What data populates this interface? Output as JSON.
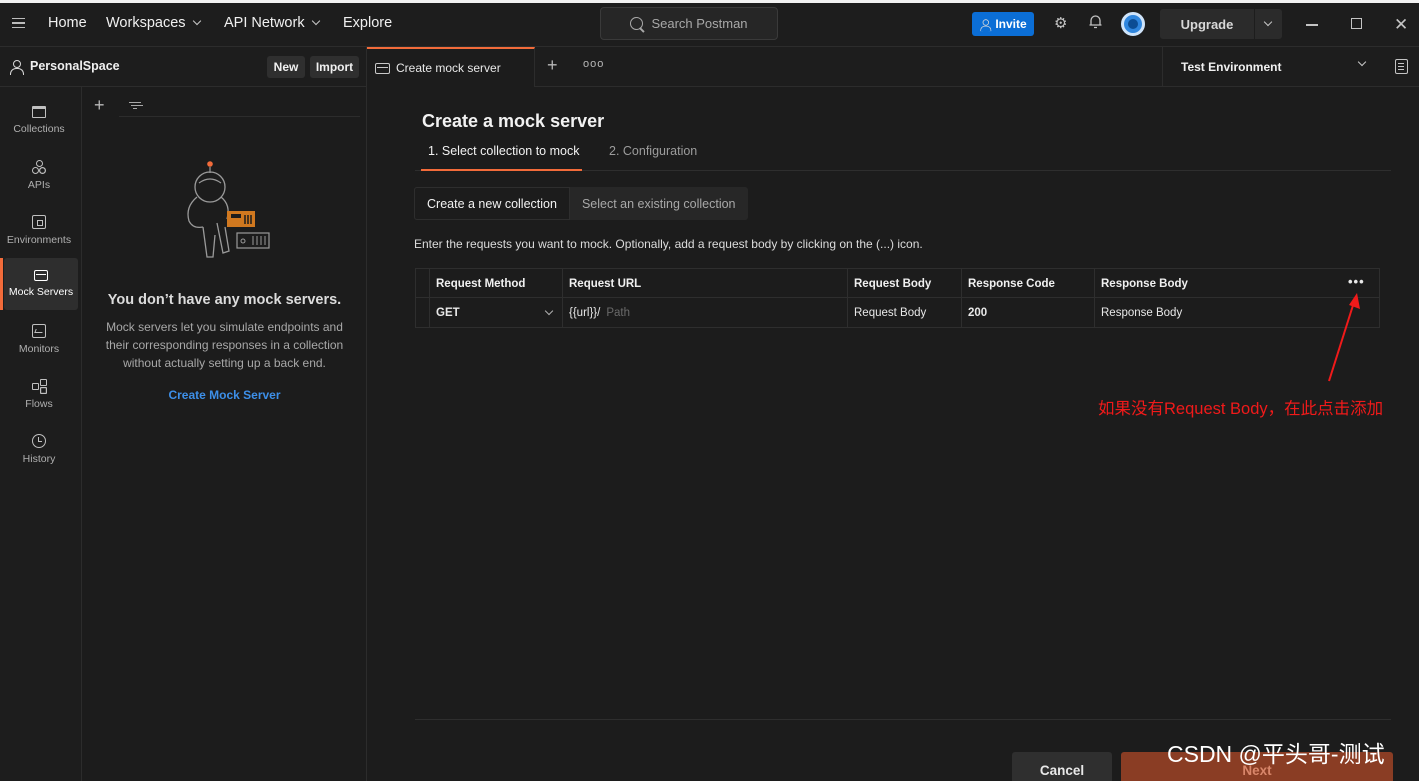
{
  "topbar": {
    "nav": [
      "Home",
      "Workspaces",
      "API Network",
      "Explore"
    ],
    "search_placeholder": "Search Postman",
    "invite_label": "Invite",
    "upgrade_label": "Upgrade"
  },
  "workspace": {
    "name": "PersonalSpace",
    "new_label": "New",
    "import_label": "Import"
  },
  "tabs": {
    "active_label": "Create mock server",
    "more_label": "ooo"
  },
  "environment": {
    "selected": "Test Environment"
  },
  "rail": {
    "items": [
      {
        "label": "Collections",
        "icon": "collections-icon"
      },
      {
        "label": "APIs",
        "icon": "apis-icon"
      },
      {
        "label": "Environments",
        "icon": "environments-icon"
      },
      {
        "label": "Mock Servers",
        "icon": "mock-servers-icon",
        "active": true
      },
      {
        "label": "Monitors",
        "icon": "monitors-icon"
      },
      {
        "label": "Flows",
        "icon": "flows-icon"
      },
      {
        "label": "History",
        "icon": "history-icon"
      }
    ]
  },
  "sidebar": {
    "empty_title": "You don’t have any mock servers.",
    "empty_desc": "Mock servers let you simulate endpoints and their corresponding responses in a collection without actually setting up a back end.",
    "create_link": "Create Mock Server"
  },
  "main": {
    "title": "Create a mock server",
    "steps": [
      "1. Select collection to mock",
      "2. Configuration"
    ],
    "options": [
      "Create a new collection",
      "Select an existing collection"
    ],
    "instruction": "Enter the requests you want to mock. Optionally, add a request body by clicking on the (...) icon.",
    "table": {
      "headers": [
        "Request Method",
        "Request URL",
        "Request Body",
        "Response Code",
        "Response Body"
      ],
      "row": {
        "method": "GET",
        "url_prefix": "{{url}}/",
        "url_placeholder": "Path",
        "body_placeholder": "Request Body",
        "code": "200",
        "response_placeholder": "Response Body"
      },
      "more_label": "•••"
    },
    "annotation": "如果没有Request Body，在此点击添加",
    "cancel_label": "Cancel",
    "next_label": "Next"
  },
  "watermark": "CSDN @平头哥-测试",
  "colors": {
    "accent": "#f26b3a",
    "invite_blue": "#0b6ed6",
    "link_blue": "#3d8fe8",
    "annotation_red": "#f01a1a"
  }
}
